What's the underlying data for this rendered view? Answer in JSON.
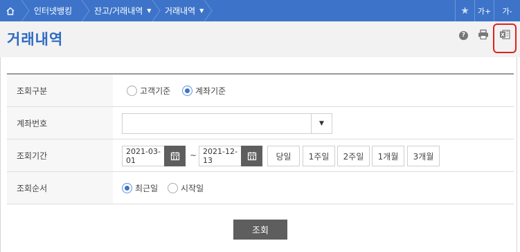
{
  "nav": {
    "home_icon": "home-icon",
    "crumbs": [
      {
        "label": "인터넷뱅킹"
      },
      {
        "label": "잔고/거래내역"
      },
      {
        "label": "거래내역"
      }
    ],
    "star_icon": "star-icon",
    "font_up": "가+",
    "font_down": "가-"
  },
  "header": {
    "title": "거래내역",
    "help": "?",
    "icons": [
      "help-icon",
      "print-icon",
      "excel-icon"
    ]
  },
  "form": {
    "rows": {
      "type": {
        "label": "조회구분",
        "options": [
          "고객기준",
          "계좌기준"
        ],
        "selected": "계좌기준"
      },
      "account": {
        "label": "계좌번호",
        "value": "",
        "arrow": "▼"
      },
      "period": {
        "label": "조회기간",
        "start": "2021-03-01",
        "separator": "~",
        "end": "2021-12-13",
        "presets": [
          "당일",
          "1주일",
          "2주일",
          "1개월",
          "3개월"
        ]
      },
      "order": {
        "label": "조회순서",
        "options": [
          "최근일",
          "시작일"
        ],
        "selected": "최근일"
      }
    },
    "submit": "조회"
  },
  "colors": {
    "nav_bg": "#3d74c9",
    "title": "#2d6ac2",
    "highlight": "#e02020",
    "button_dark": "#5e5e5e"
  }
}
